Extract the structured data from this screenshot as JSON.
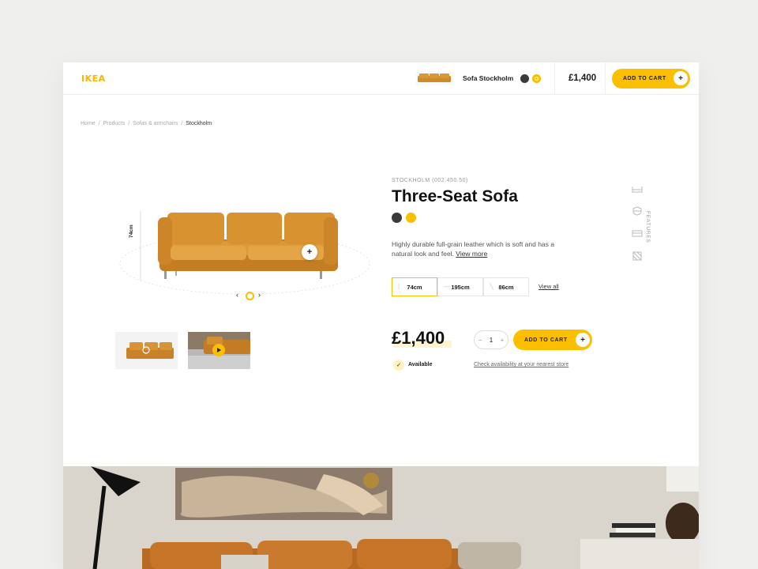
{
  "header": {
    "logo": "IKEA",
    "product_name": "Sofa Stockholm",
    "price": "£1,400",
    "add_to_cart": "ADD TO CART",
    "plus": "+"
  },
  "breadcrumb": [
    "Home",
    "Products",
    "Sofas & armchairs",
    "Stockholm"
  ],
  "breadcrumb_sep": "/",
  "product": {
    "sku": "STOCKHOLM (002.450.50)",
    "title": "Three-Seat Sofa",
    "description": "Highly durable full-grain leather which is soft and has a natural look and feel.",
    "view_more": "View more",
    "height_label": "74cm",
    "dimensions": [
      {
        "label": "74cm",
        "active": true
      },
      {
        "label": "195cm",
        "active": false
      },
      {
        "label": "86cm",
        "active": false
      }
    ],
    "view_all": "View all",
    "price": "£1,400",
    "quantity": "1",
    "qty_minus": "−",
    "qty_plus": "+",
    "add_to_cart": "ADD TO CART",
    "plus": "+",
    "availability": "Available",
    "check_store": "Check availability at your nearest store",
    "features_label": "FEATURES"
  },
  "colors": {
    "accent": "#fbbf00",
    "swatch_dark": "#3a3a3a",
    "swatch_yellow": "#fbbf00",
    "leather": "#d4902f"
  }
}
